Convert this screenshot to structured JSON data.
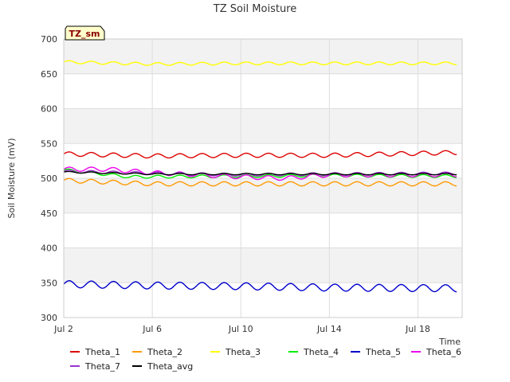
{
  "chart_data": {
    "type": "line",
    "title": "TZ Soil Moisture",
    "tag": "TZ_sm",
    "xlabel": "Time",
    "ylabel": "Soil Moisture (mV)",
    "ylim": [
      300,
      700
    ],
    "yticks": [
      300,
      350,
      400,
      450,
      500,
      550,
      600,
      650,
      700
    ],
    "xlim": [
      "2024-07-02",
      "2024-07-20"
    ],
    "xticks": [
      {
        "date": "2024-07-02",
        "label": "Jul 2"
      },
      {
        "date": "2024-07-06",
        "label": "Jul 6"
      },
      {
        "date": "2024-07-10",
        "label": "Jul 10"
      },
      {
        "date": "2024-07-14",
        "label": "Jul 14"
      },
      {
        "date": "2024-07-18",
        "label": "Jul 18"
      }
    ],
    "grid": true,
    "legend_position": "bottom",
    "series": [
      {
        "name": "Theta_1",
        "color": "#dd0000",
        "start": "2024-07-02",
        "end": "2024-07-19.75",
        "base": 533,
        "amp": 3,
        "period": 1,
        "points": [
          [
            "2024-07-02",
            535
          ],
          [
            "2024-07-06",
            532
          ],
          [
            "2024-07-10",
            533
          ],
          [
            "2024-07-14",
            533
          ],
          [
            "2024-07-19.75",
            537
          ]
        ]
      },
      {
        "name": "Theta_2",
        "color": "#ff9900",
        "start": "2024-07-02",
        "end": "2024-07-19.75",
        "base": 493,
        "amp": 3,
        "period": 1,
        "points": [
          [
            "2024-07-02",
            497
          ],
          [
            "2024-07-06",
            492
          ],
          [
            "2024-07-10",
            492
          ],
          [
            "2024-07-14",
            492
          ],
          [
            "2024-07-19.75",
            492
          ]
        ]
      },
      {
        "name": "Theta_3",
        "color": "#ffff00",
        "start": "2024-07-02",
        "end": "2024-07-19.75",
        "base": 665,
        "amp": 2,
        "period": 1,
        "points": [
          [
            "2024-07-02",
            667
          ],
          [
            "2024-07-06",
            664
          ],
          [
            "2024-07-10",
            665
          ],
          [
            "2024-07-14",
            665
          ],
          [
            "2024-07-19.75",
            665
          ]
        ]
      },
      {
        "name": "Theta_4",
        "color": "#00ee00",
        "start": "2024-07-02",
        "end": "2024-07-19.75",
        "base": 505,
        "amp": 2,
        "period": 1,
        "points": [
          [
            "2024-07-02",
            512
          ],
          [
            "2024-07-05",
            502
          ],
          [
            "2024-07-10",
            503
          ],
          [
            "2024-07-14",
            504
          ],
          [
            "2024-07-19.75",
            503
          ]
        ]
      },
      {
        "name": "Theta_5",
        "color": "#0000cc",
        "start": "2024-07-02",
        "end": "2024-07-19.75",
        "base": 345,
        "amp": 5,
        "period": 1,
        "points": [
          [
            "2024-07-02",
            348
          ],
          [
            "2024-07-06",
            346
          ],
          [
            "2024-07-10",
            345
          ],
          [
            "2024-07-14",
            343
          ],
          [
            "2024-07-19.75",
            342
          ]
        ]
      },
      {
        "name": "Theta_6",
        "color": "#ee00ee",
        "start": "2024-07-02",
        "end": "2024-07-19.75",
        "base": 508,
        "amp": 3,
        "period": 1,
        "points": [
          [
            "2024-07-02",
            513
          ],
          [
            "2024-07-04",
            513
          ],
          [
            "2024-07-06",
            508
          ],
          [
            "2024-07-10",
            502
          ],
          [
            "2024-07-12",
            500
          ],
          [
            "2024-07-14",
            505
          ],
          [
            "2024-07-19.75",
            505
          ]
        ]
      },
      {
        "name": "Theta_7",
        "color": "#9933cc",
        "start": "2024-07-02",
        "end": "2024-07-19.75",
        "base": 506,
        "amp": 2,
        "period": 1,
        "points": [
          [
            "2024-07-02",
            510
          ],
          [
            "2024-07-06",
            507
          ],
          [
            "2024-07-10",
            505
          ],
          [
            "2024-07-14",
            506
          ],
          [
            "2024-07-19.75",
            507
          ]
        ]
      },
      {
        "name": "Theta_avg",
        "color": "#000000",
        "start": "2024-07-02",
        "end": "2024-07-19.75",
        "base": 506,
        "amp": 1,
        "period": 1,
        "points": [
          [
            "2024-07-02",
            509
          ],
          [
            "2024-07-06",
            506
          ],
          [
            "2024-07-10",
            506
          ],
          [
            "2024-07-14",
            506
          ],
          [
            "2024-07-19.75",
            506
          ]
        ]
      }
    ]
  }
}
